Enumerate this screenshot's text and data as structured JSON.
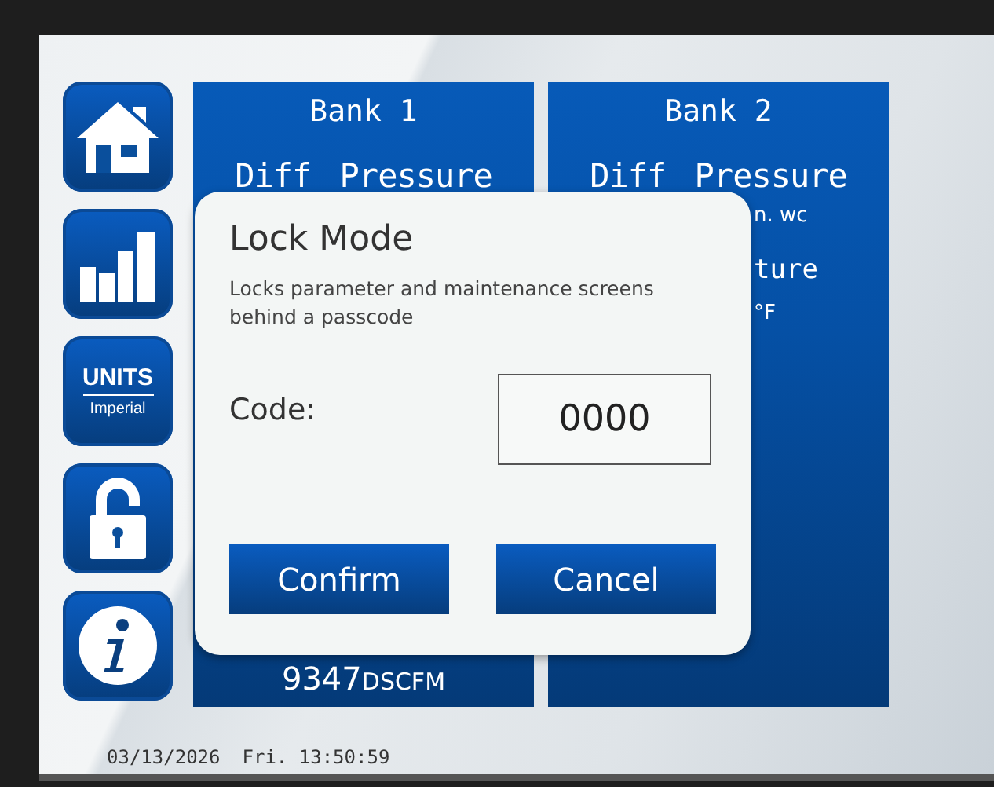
{
  "sidebar": {
    "buttons": [
      {
        "kind": "home"
      },
      {
        "kind": "chart"
      },
      {
        "kind": "units",
        "label": "UNITS",
        "value": "Imperial"
      },
      {
        "kind": "lock"
      },
      {
        "kind": "info"
      }
    ]
  },
  "banks": [
    {
      "title": "Bank 1",
      "heading": "Diff Pressure",
      "flow_value": "9347",
      "flow_unit": "DSCFM"
    },
    {
      "title": "Bank 2",
      "heading": "Diff Pressure",
      "fragments": [
        "n. wc",
        "ture",
        "°F"
      ]
    }
  ],
  "dialog": {
    "title": "Lock Mode",
    "description": "Locks parameter and maintenance screens behind a passcode",
    "code_label": "Code:",
    "code_value": "0000",
    "buttons": [
      "Confirm",
      "Cancel"
    ]
  },
  "status_bar": {
    "date": "03/13/2026",
    "time": "Fri. 13:50:59"
  }
}
